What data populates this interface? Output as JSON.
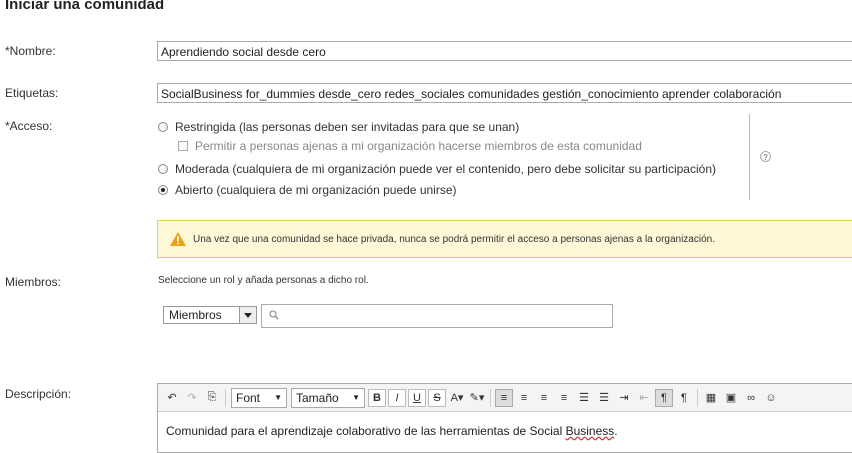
{
  "page": {
    "title": "Iniciar una comunidad"
  },
  "form": {
    "name_label": "*Nombre:",
    "name_value": "Aprendiendo social desde cero",
    "tags_label": "Etiquetas:",
    "tags_value": "SocialBusiness for_dummies desde_cero redes_sociales comunidades gestión_conocimiento aprender colaboración",
    "access_label": "*Acceso:",
    "access_options": [
      {
        "label": "Restringida (las personas deben ser invitadas para que se unan)",
        "selected": false
      },
      {
        "label": "Moderada (cualquiera de mi organización puede ver el contenido, pero debe solicitar su participación)",
        "selected": false
      },
      {
        "label": "Abierto (cualquiera de mi organización puede unirse)",
        "selected": true
      }
    ],
    "external_checkbox_label": "Permitir a personas ajenas a mi organización hacerse miembros de esta comunidad",
    "help_icon": "question-mark-icon",
    "warning_text": "Una vez que una comunidad se hace privada, nunca se podrá permitir el acceso a personas ajenas a la organización.",
    "members_label": "Miembros:",
    "members_hint": "Seleccione un rol y añada personas a dicho rol.",
    "role_selected": "Miembros",
    "search_placeholder": "",
    "description_label": "Descripción:",
    "editor_font": "Font",
    "editor_size": "Tamaño",
    "description_text_before": "Comunidad para el aprendizaje colaborativo de las herramientas de Social ",
    "description_text_spell": "Business",
    "description_text_after": "."
  },
  "colors": {
    "warning_bg": "#fff8d6",
    "warning_border": "#e8c86a"
  }
}
